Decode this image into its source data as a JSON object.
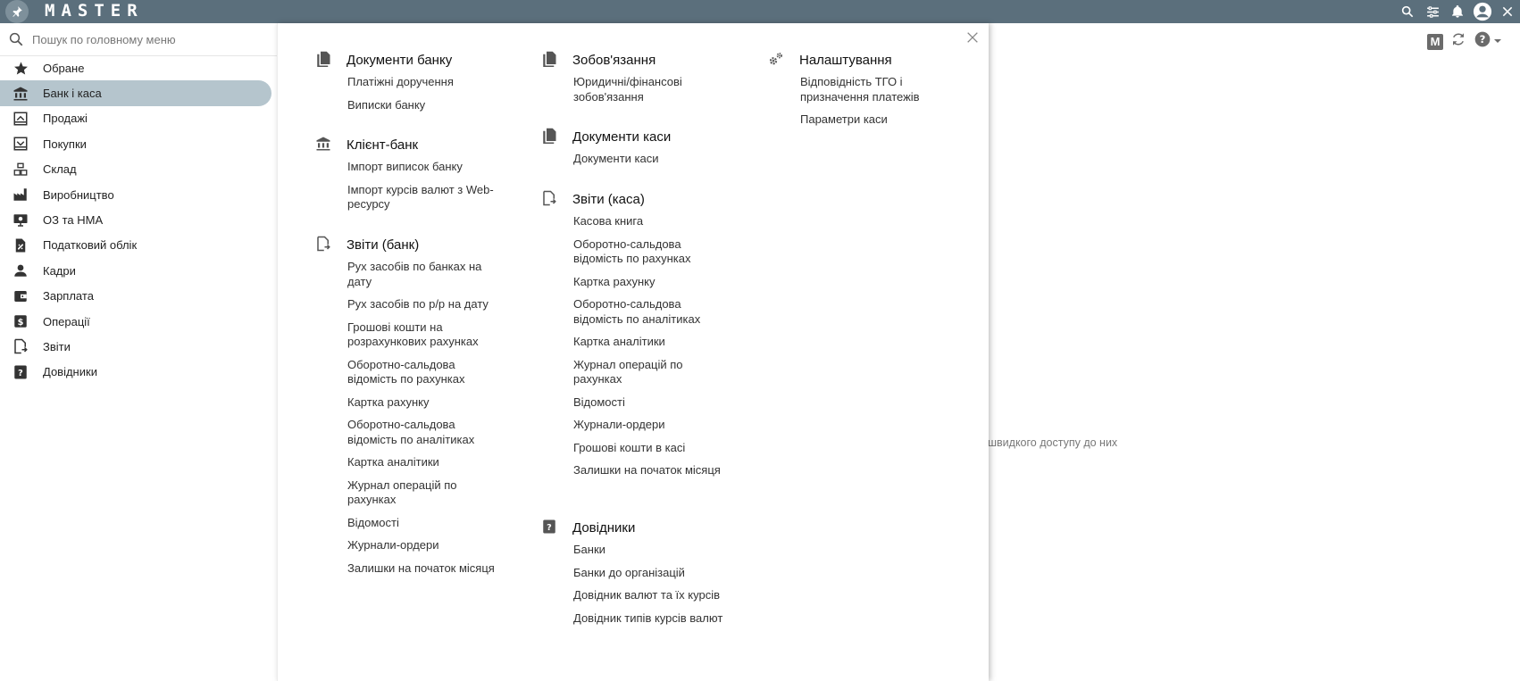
{
  "app": {
    "logo_text": "MASTER"
  },
  "topbar": {
    "icons": [
      "search-icon",
      "tune-icon",
      "bell-icon",
      "account-icon",
      "close-icon"
    ]
  },
  "search": {
    "placeholder": "Пошук по головному меню"
  },
  "sidebar": {
    "items": [
      {
        "label": "Обране",
        "icon": "star-icon"
      },
      {
        "label": "Банк і каса",
        "icon": "bank-icon",
        "active": true
      },
      {
        "label": "Продажі",
        "icon": "sales-icon"
      },
      {
        "label": "Покупки",
        "icon": "purchases-icon"
      },
      {
        "label": "Склад",
        "icon": "warehouse-icon"
      },
      {
        "label": "Виробництво",
        "icon": "factory-icon"
      },
      {
        "label": "ОЗ та НМА",
        "icon": "assets-icon"
      },
      {
        "label": "Податковий облік",
        "icon": "tax-icon"
      },
      {
        "label": "Кадри",
        "icon": "person-icon"
      },
      {
        "label": "Зарплата",
        "icon": "wallet-icon"
      },
      {
        "label": "Операції",
        "icon": "dollar-icon"
      },
      {
        "label": "Звіти",
        "icon": "reports-icon"
      },
      {
        "label": "Довідники",
        "icon": "help-book-icon"
      }
    ]
  },
  "menu": {
    "col1": [
      {
        "title": "Документи банку",
        "icon": "documents-icon",
        "items": [
          "Платіжні доручення",
          "Виписки банку"
        ]
      },
      {
        "title": "Клієнт-банк",
        "icon": "bank-icon",
        "items": [
          "Імпорт виписок банку",
          "Імпорт курсів валют з Web-ресурсу"
        ]
      },
      {
        "title": "Звіти (банк)",
        "icon": "reports-icon",
        "items": [
          "Рух засобів по банках на дату",
          "Рух засобів по р/р на дату",
          "Грошові кошти на розрахункових рахунках",
          "Оборотно-сальдова відомість по рахунках",
          "Картка рахунку",
          "Оборотно-сальдова відомість по аналітиках",
          "Картка аналітики",
          "Журнал операцій по рахунках",
          "Відомості",
          "Журнали-ордери",
          "Залишки на початок місяця"
        ]
      }
    ],
    "col2": [
      {
        "title": "Зобов'язання",
        "icon": "documents-icon",
        "items": [
          "Юридичні/фінансові зобов'язання"
        ]
      },
      {
        "title": "Документи каси",
        "icon": "documents-icon",
        "items": [
          "Документи каси"
        ]
      },
      {
        "title": "Звіти (каса)",
        "icon": "reports-icon",
        "items": [
          "Касова книга",
          "Оборотно-сальдова відомість по рахунках",
          "Картка рахунку",
          "Оборотно-сальдова відомість по аналітиках",
          "Картка аналітики",
          "Журнал операцій по рахунках",
          "Відомості",
          "Журнали-ордери",
          "Грошові кошти в касі",
          "Залишки на початок місяця"
        ]
      },
      {
        "title": "Довідники",
        "icon": "help-book-icon",
        "items": [
          "Банки",
          "Банки до організацій",
          "Довідник валют та їх курсів",
          "Довідник типів курсів валют"
        ]
      }
    ],
    "col3": [
      {
        "title": "Налаштування",
        "icon": "settings-icon",
        "items": [
          "Відповідність ТГО і призначення платежів",
          "Параметри каси"
        ]
      }
    ]
  },
  "background": {
    "text": "швидкого доступу до них"
  },
  "toolbar_right": {
    "m_label": "M",
    "icons": [
      "m-icon",
      "refresh-icon",
      "help-icon",
      "dropdown-icon"
    ]
  }
}
